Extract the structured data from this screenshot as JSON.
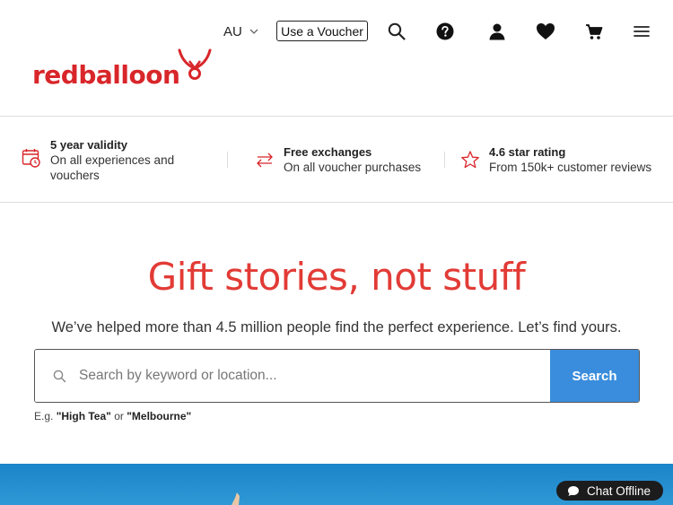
{
  "header": {
    "logo_text": "redballoon",
    "country": "AU",
    "voucher_label": "Use a Voucher",
    "icons": [
      "search-icon",
      "help-icon",
      "account-icon",
      "wishlist-icon",
      "cart-icon",
      "menu-icon"
    ]
  },
  "features": [
    {
      "icon": "calendar-clock-icon",
      "title": "5 year validity",
      "desc_line1": "On all experiences and",
      "desc_line2": "vouchers"
    },
    {
      "icon": "exchange-arrows-icon",
      "title": "Free exchanges",
      "desc_line1": "On all voucher purchases"
    },
    {
      "icon": "star-outline-icon",
      "title": "4.6 star rating",
      "desc_line1": "From 150k+ customer reviews"
    }
  ],
  "hero": {
    "title": "Gift stories, not stuff",
    "subtitle": "We’ve helped more than 4.5 million people find the perfect experience. Let’s find yours."
  },
  "search": {
    "placeholder": "Search by keyword or location...",
    "value": "",
    "button_label": "Search",
    "example_prefix": "E.g. ",
    "example_1": "\"High Tea\"",
    "example_or": " or ",
    "example_2": "\"Melbourne\""
  },
  "chat": {
    "label": "Chat Offline"
  },
  "colors": {
    "brand_red": "#d8262a",
    "hero_red": "#e23b36",
    "search_blue": "#3a8ddc",
    "banner_blue": "#1a84c9"
  }
}
